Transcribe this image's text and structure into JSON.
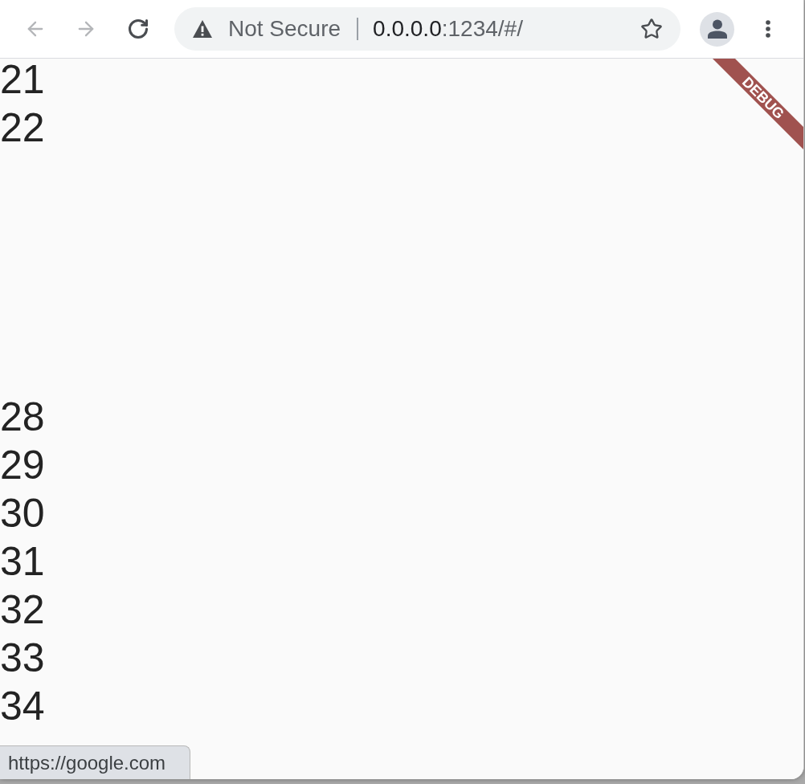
{
  "nav_buttons": [
    {
      "kind": "back",
      "disabled": true
    },
    {
      "kind": "forward",
      "disabled": true
    },
    {
      "kind": "reload",
      "disabled": false
    }
  ],
  "address_bar": {
    "security_label": "Not Secure",
    "url_host": "0.0.0.0",
    "url_path": ":1234/#/",
    "bookmarked": false
  },
  "debug_banner": {
    "label": "DEBUG"
  },
  "list": [
    {
      "kind": "number",
      "text": "21"
    },
    {
      "kind": "number",
      "text": "22"
    },
    {
      "kind": "empty"
    },
    {
      "kind": "empty"
    },
    {
      "kind": "empty"
    },
    {
      "kind": "empty"
    },
    {
      "kind": "empty"
    },
    {
      "kind": "number",
      "text": "28"
    },
    {
      "kind": "number",
      "text": "29"
    },
    {
      "kind": "number",
      "text": "30"
    },
    {
      "kind": "number",
      "text": "31"
    },
    {
      "kind": "number",
      "text": "32"
    },
    {
      "kind": "number",
      "text": "33"
    },
    {
      "kind": "number",
      "text": "34"
    }
  ],
  "status_bubble": {
    "text": "https://google.com"
  }
}
